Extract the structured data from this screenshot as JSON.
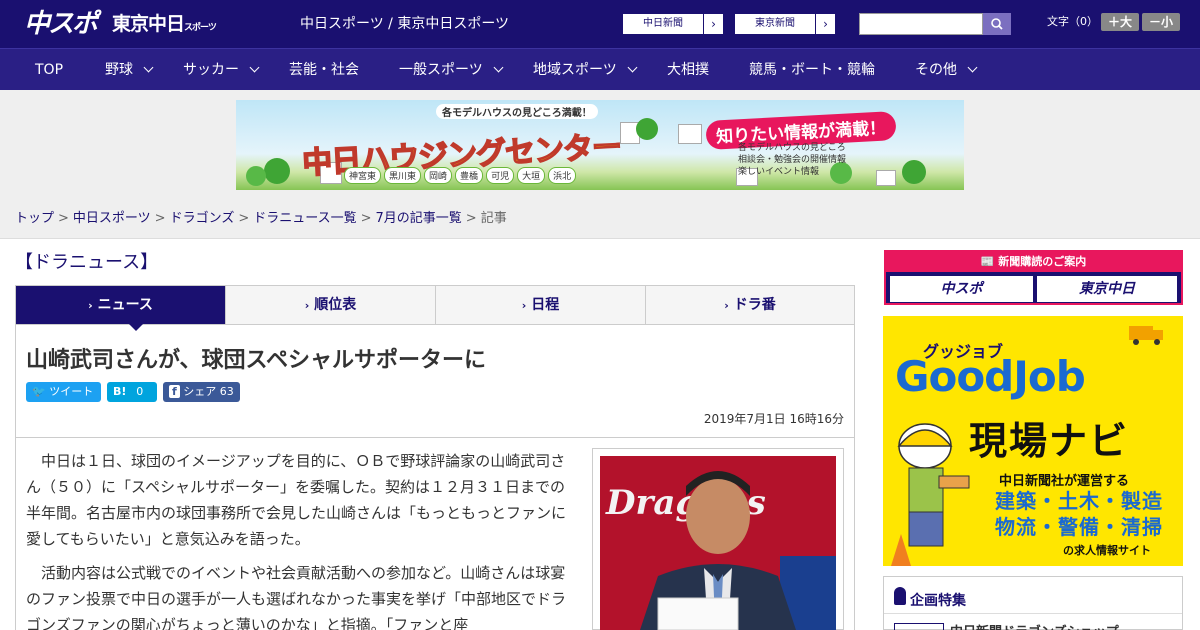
{
  "header": {
    "logo_chuspo": "中スポ",
    "logo_tokyo": "東京中日",
    "logo_tokyo_sub": "スポーツ",
    "site_title": "中日スポーツ / 東京中日スポーツ",
    "paper_buttons": [
      {
        "label": "中日新聞"
      },
      {
        "label": "東京新聞"
      }
    ],
    "search": {
      "value": "",
      "placeholder": ""
    },
    "font_size_label": "文字（0）",
    "font_bigger": "＋大",
    "font_smaller": "－小"
  },
  "nav": {
    "items": [
      {
        "label": "TOP",
        "dropdown": false
      },
      {
        "label": "野球",
        "dropdown": true
      },
      {
        "label": "サッカー",
        "dropdown": true
      },
      {
        "label": "芸能・社会",
        "dropdown": false
      },
      {
        "label": "一般スポーツ",
        "dropdown": true
      },
      {
        "label": "地域スポーツ",
        "dropdown": true
      },
      {
        "label": "大相撲",
        "dropdown": false
      },
      {
        "label": "競馬・ボート・競輪",
        "dropdown": false
      },
      {
        "label": "その他",
        "dropdown": true
      }
    ]
  },
  "banner": {
    "tagline": "各モデルハウスの見どころ満載！",
    "title": "中日ハウジングセンター",
    "headline": "知りたい情報が満載！",
    "points": [
      "各モデルハウスの見どころ",
      "相談会・勉強会の開催情報",
      "楽しいイベント情報"
    ],
    "cities": [
      "神宮東",
      "黒川東",
      "岡崎",
      "豊橋",
      "可児",
      "大垣",
      "浜北"
    ]
  },
  "breadcrumb": {
    "items": [
      "トップ",
      "中日スポーツ",
      "ドラゴンズ",
      "ドラニュース一覧",
      "7月の記事一覧"
    ],
    "current": "記事",
    "separator": ">"
  },
  "section": {
    "title": "【ドラニュース】"
  },
  "tabs": [
    {
      "label": "ニュース",
      "active": true
    },
    {
      "label": "順位表",
      "active": false
    },
    {
      "label": "日程",
      "active": false
    },
    {
      "label": "ドラ番",
      "active": false
    }
  ],
  "article": {
    "title": "山崎武司さんが、球団スペシャルサポーターに",
    "share": {
      "tweet": "ツイート",
      "hatena_icon": "B!",
      "hatena_count": "0",
      "fb_label": "シェア",
      "fb_count": "63"
    },
    "date": "2019年7月1日 16時16分",
    "paragraphs": [
      "中日は１日、球団のイメージアップを目的に、ＯＢで野球評論家の山崎武司さん（５０）に「スペシャルサポーター」を委嘱した。契約は１２月３１日までの半年間。名古屋市内の球団事務所で会見した山崎さんは「もっともっとファンに愛してもらいたい」と意気込みを語った。",
      "活動内容は公式戦でのイベントや社会貢献活動への参加など。山崎さんは球宴のファン投票で中日の選手が一人も選ばれなかった事実を挙げ「中部地区でドラゴンズファンの関心がちょっと薄いのかな」と指摘。「ファンと座"
    ],
    "photo_text": "Dragons"
  },
  "sidebar": {
    "subscription": {
      "heading": "新聞購読のご案内",
      "logos": [
        "中スポ",
        "東京中日"
      ]
    },
    "goodjob": {
      "small": "グッジョブ",
      "title": "GoodJob",
      "navi": "現場ナビ",
      "operator": "中日新聞社が運営する",
      "jobs": [
        "建築・土木・製造",
        "物流・警備・清掃"
      ],
      "footer": "の求人情報サイト"
    },
    "feature": {
      "title": "企画特集",
      "first_item": "中日新聞ドラゴンズショップ"
    }
  },
  "colors": {
    "brand_navy": "#1a1070",
    "nav_bg": "#2a1f85",
    "accent_pink": "#e8175d",
    "goodjob_yellow": "#ffe600",
    "twitter": "#1da1f2",
    "hatena": "#00a4de",
    "facebook": "#3b5998"
  }
}
